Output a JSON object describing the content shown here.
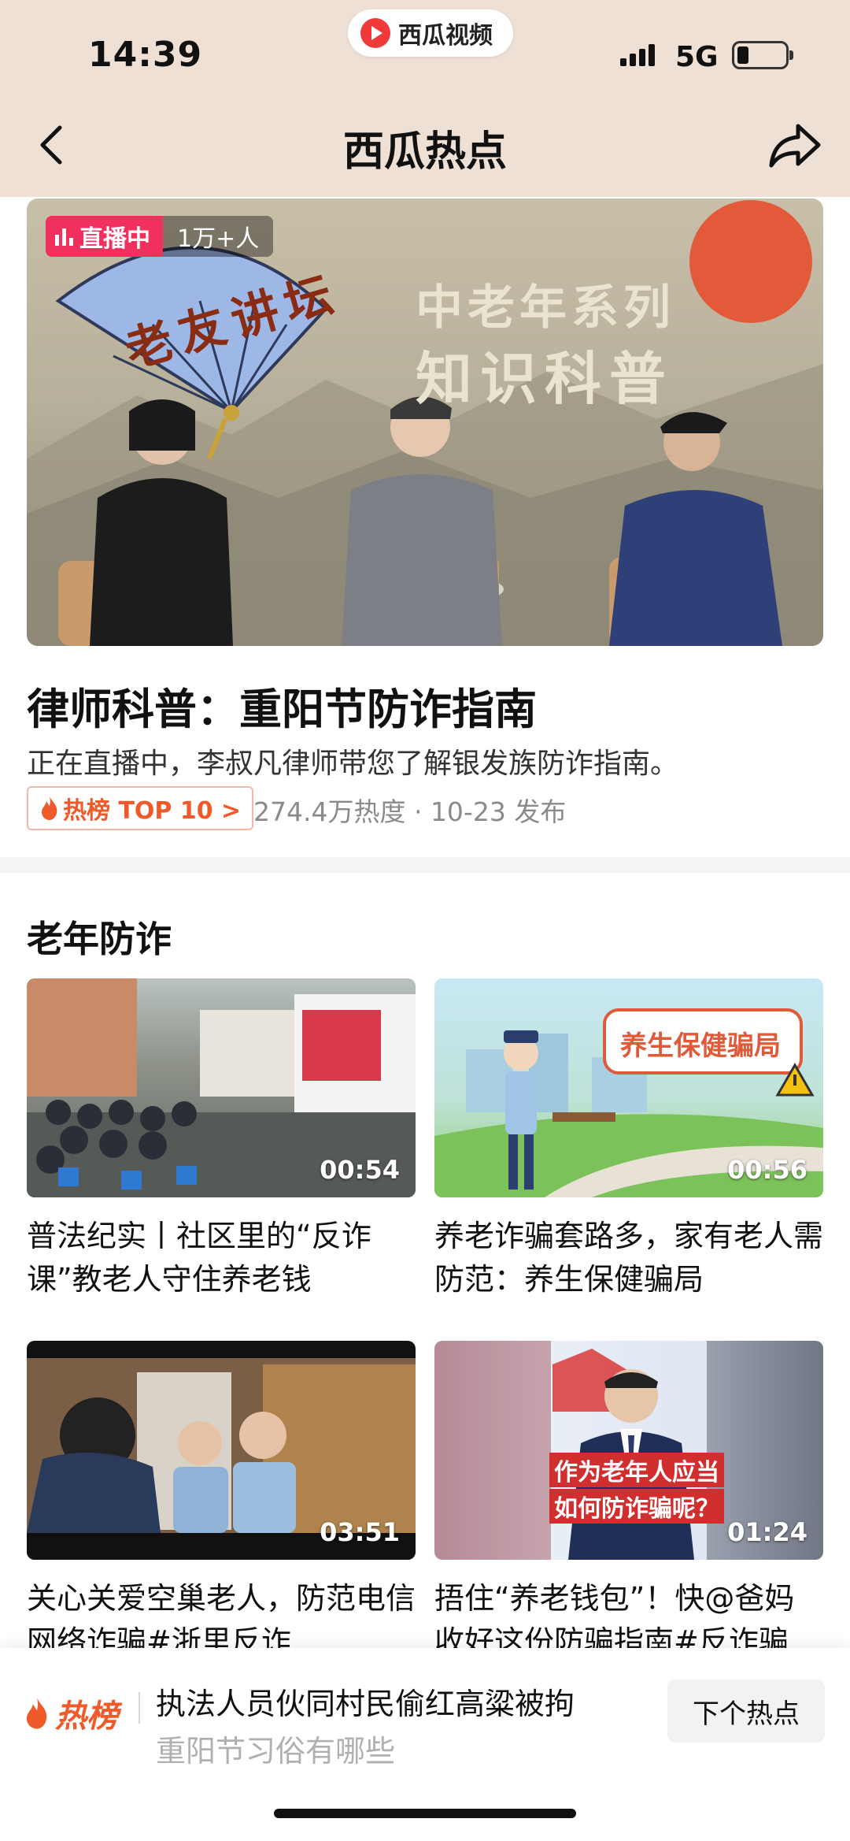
{
  "status_bar": {
    "time": "14:39",
    "app_name": "西瓜视频",
    "network": "5G"
  },
  "header": {
    "title": "西瓜热点"
  },
  "live_banner": {
    "badge_label": "直播中",
    "viewer_count": "1万+人",
    "fan_text": "老友讲坛",
    "slogan_line1": "中老年系列",
    "slogan_line2": "知识科普"
  },
  "featured": {
    "title": "律师科普：重阳节防诈指南",
    "subtitle": "正在直播中，李叔凡律师带您了解银发族防诈指南。",
    "hot_tag": "热榜 TOP 10 >",
    "meta": "274.4万热度 · 10-23 发布"
  },
  "section": {
    "title": "老年防诈"
  },
  "videos": [
    {
      "duration": "00:54",
      "title": "普法纪实丨社区里的“反诈课”教老人守住养老钱"
    },
    {
      "duration": "00:56",
      "title": "养老诈骗套路多，家有老人需防范：养生保健骗局",
      "overlay": "养生保健骗局"
    },
    {
      "duration": "03:51",
      "title": "关心关爱空巢老人，防范电信网络诈骗#浙里反诈"
    },
    {
      "duration": "01:24",
      "title": "捂住“养老钱包”！快@爸妈收好这份防骗指南#反诈骗",
      "overlay_line1": "作为老年人应当",
      "overlay_line2": "如何防诈骗呢？"
    }
  ],
  "bottom_bar": {
    "logo_label": "热榜",
    "main_text": "执法人员伙同村民偷红高粱被拘",
    "sub_text": "重阳节习俗有哪些",
    "next_button": "下个热点"
  },
  "colors": {
    "header_bg": "#efe0d6",
    "live_pink": "#f1305e",
    "hot_orange": "#f05a2a"
  }
}
